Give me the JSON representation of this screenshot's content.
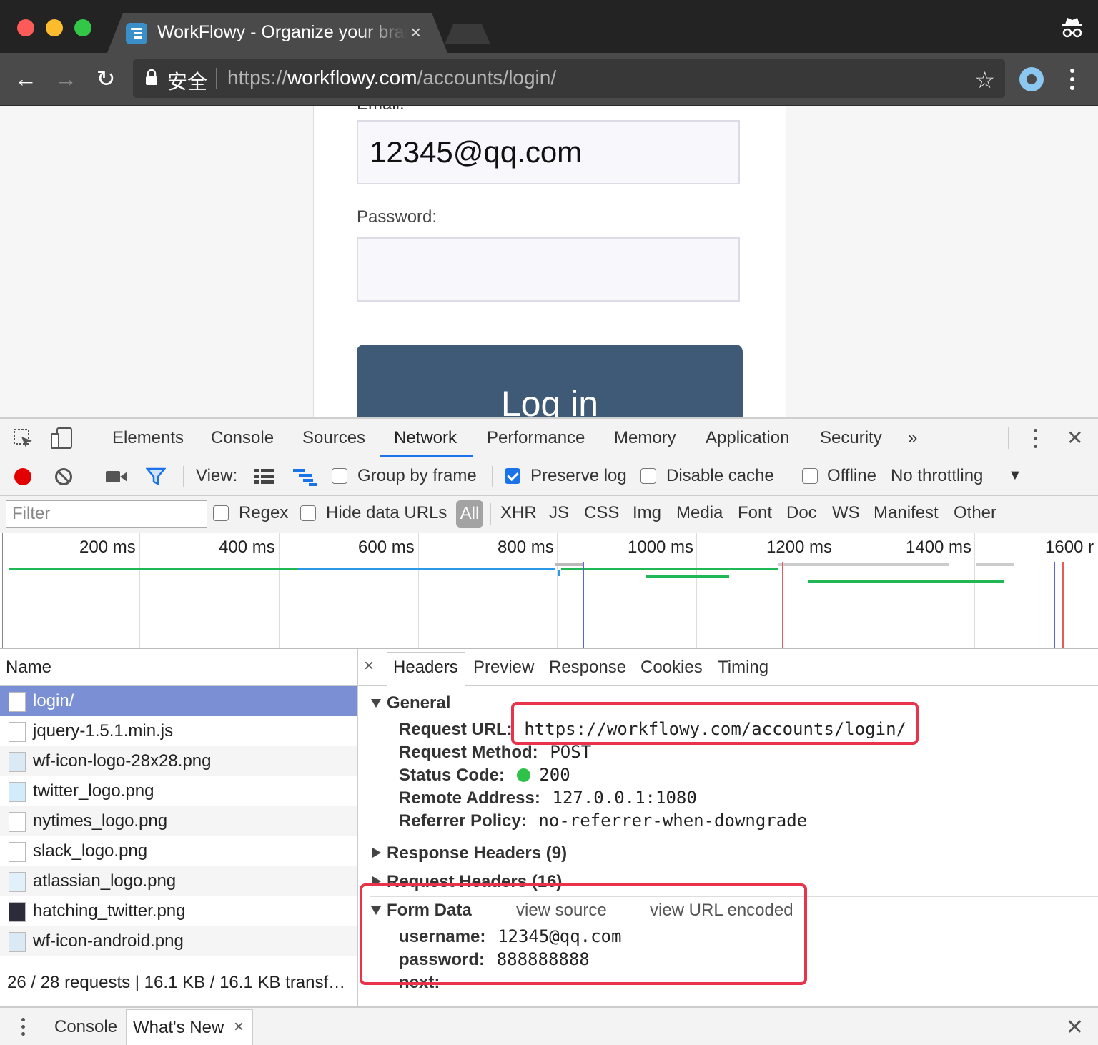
{
  "browser": {
    "tab_title": "WorkFlowy - Organize your brain",
    "tab_close": "×",
    "secure_label": "安全",
    "url_scheme": "https://",
    "url_host": "workflowy.com",
    "url_path": "/accounts/login/"
  },
  "page": {
    "email_label": "Email:",
    "email_value": "12345@qq.com",
    "password_label": "Password:",
    "password_value": "",
    "login_button": "Log in"
  },
  "devtools": {
    "tabs": [
      "Elements",
      "Console",
      "Sources",
      "Network",
      "Performance",
      "Memory",
      "Application",
      "Security"
    ],
    "more": "»",
    "close": "✕",
    "toolbar": {
      "view_label": "View:",
      "group_by_frame": "Group by frame",
      "preserve_log": "Preserve log",
      "disable_cache": "Disable cache",
      "offline": "Offline",
      "throttling": "No throttling",
      "preserve_log_checked": true
    },
    "filter": {
      "placeholder": "Filter",
      "regex": "Regex",
      "hide_data_urls": "Hide data URLs",
      "types": [
        "All",
        "XHR",
        "JS",
        "CSS",
        "Img",
        "Media",
        "Font",
        "Doc",
        "WS",
        "Manifest",
        "Other"
      ]
    },
    "timeline_ticks": [
      "200 ms",
      "400 ms",
      "600 ms",
      "800 ms",
      "1000 ms",
      "1200 ms",
      "1400 ms",
      "1600 r"
    ],
    "requests": {
      "header": "Name",
      "items": [
        {
          "name": "login/",
          "icon": "document-icon"
        },
        {
          "name": "jquery-1.5.1.min.js",
          "icon": "script-icon"
        },
        {
          "name": "wf-icon-logo-28x28.png",
          "icon": "workflowy-icon"
        },
        {
          "name": "twitter_logo.png",
          "icon": "twitter-icon"
        },
        {
          "name": "nytimes_logo.png",
          "icon": "nytimes-icon"
        },
        {
          "name": "slack_logo.png",
          "icon": "slack-icon"
        },
        {
          "name": "atlassian_logo.png",
          "icon": "atlassian-icon"
        },
        {
          "name": "hatching_twitter.png",
          "icon": "image-icon"
        },
        {
          "name": "wf-icon-android.png",
          "icon": "workflowy-icon"
        }
      ],
      "status": "26 / 28 requests | 16.1 KB / 16.1 KB transf…"
    },
    "detail": {
      "close": "×",
      "tabs": [
        "Headers",
        "Preview",
        "Response",
        "Cookies",
        "Timing"
      ],
      "general_title": "General",
      "general": [
        {
          "key": "Request URL:",
          "value": "https://workflowy.com/accounts/login/"
        },
        {
          "key": "Request Method:",
          "value": "POST"
        },
        {
          "key": "Status Code:",
          "value": "200"
        },
        {
          "key": "Remote Address:",
          "value": "127.0.0.1:1080"
        },
        {
          "key": "Referrer Policy:",
          "value": "no-referrer-when-downgrade"
        }
      ],
      "response_headers": "Response Headers (9)",
      "request_headers": "Request Headers (16)",
      "form_data_title": "Form Data",
      "view_source": "view source",
      "view_url_encoded": "view URL encoded",
      "form_data": [
        {
          "key": "username:",
          "value": "12345@qq.com"
        },
        {
          "key": "password:",
          "value": "888888888"
        },
        {
          "key": "next:",
          "value": ""
        }
      ]
    },
    "drawer": {
      "console": "Console",
      "whats_new": "What's New",
      "tab_close": "×",
      "close": "✕"
    }
  },
  "colors": {
    "highlight_box": "#e8334a",
    "selected_row": "#7b8fd4",
    "login_button": "#3f5a77",
    "status_ok": "#2fc24a"
  }
}
